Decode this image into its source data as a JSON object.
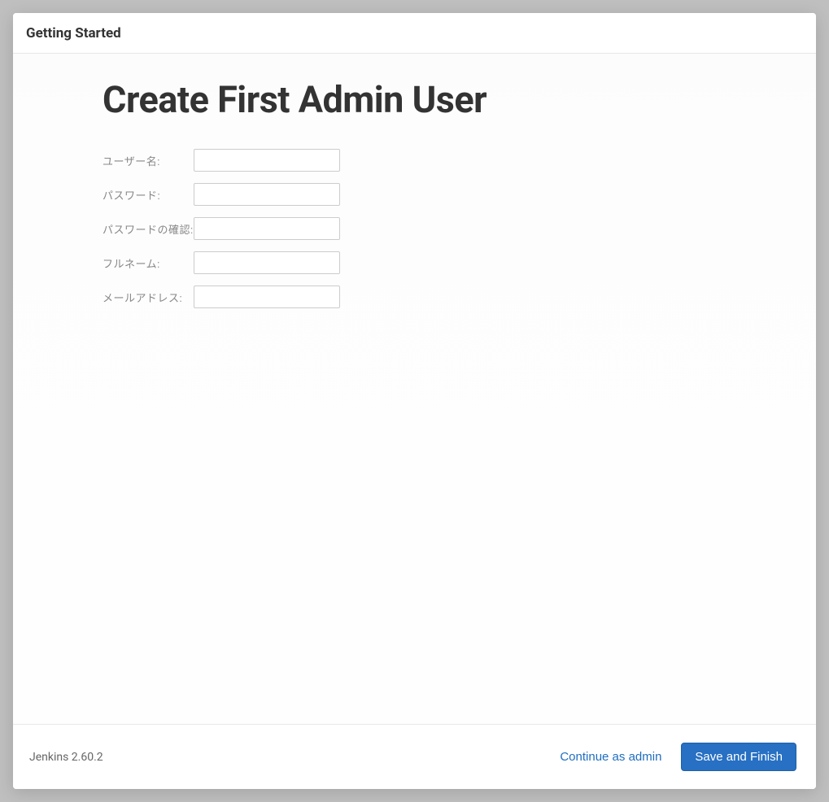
{
  "header": {
    "title": "Getting Started"
  },
  "main": {
    "heading": "Create First Admin User",
    "fields": {
      "username": {
        "label": "ユーザー名:",
        "value": ""
      },
      "password": {
        "label": "パスワード:",
        "value": ""
      },
      "password_confirm": {
        "label": "パスワードの確認:",
        "value": ""
      },
      "fullname": {
        "label": "フルネーム:",
        "value": ""
      },
      "email": {
        "label": "メールアドレス:",
        "value": ""
      }
    }
  },
  "footer": {
    "version": "Jenkins 2.60.2",
    "continue_label": "Continue as admin",
    "save_label": "Save and Finish"
  }
}
